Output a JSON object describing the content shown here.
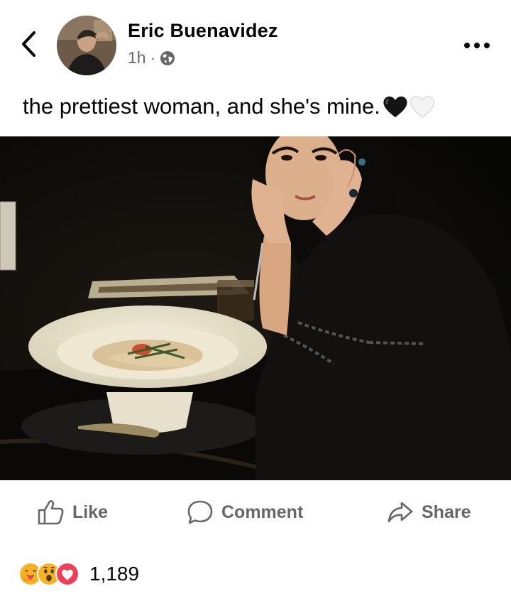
{
  "post": {
    "author": "Eric Buenavidez",
    "time": "1h",
    "separator": "·",
    "privacy_icon": "globe-icon",
    "caption": "the prettiest woman, and she's mine.",
    "caption_emoji": [
      "black-heart",
      "white-heart"
    ]
  },
  "actions": {
    "like_label": "Like",
    "comment_label": "Comment",
    "share_label": "Share"
  },
  "reactions": {
    "icons": [
      "hug-reaction",
      "wow-reaction",
      "love-reaction"
    ],
    "count": "1,189"
  },
  "colors": {
    "text": "#050505",
    "secondary": "#65676b",
    "love": "#f33e58",
    "wow": "#f7b125"
  }
}
